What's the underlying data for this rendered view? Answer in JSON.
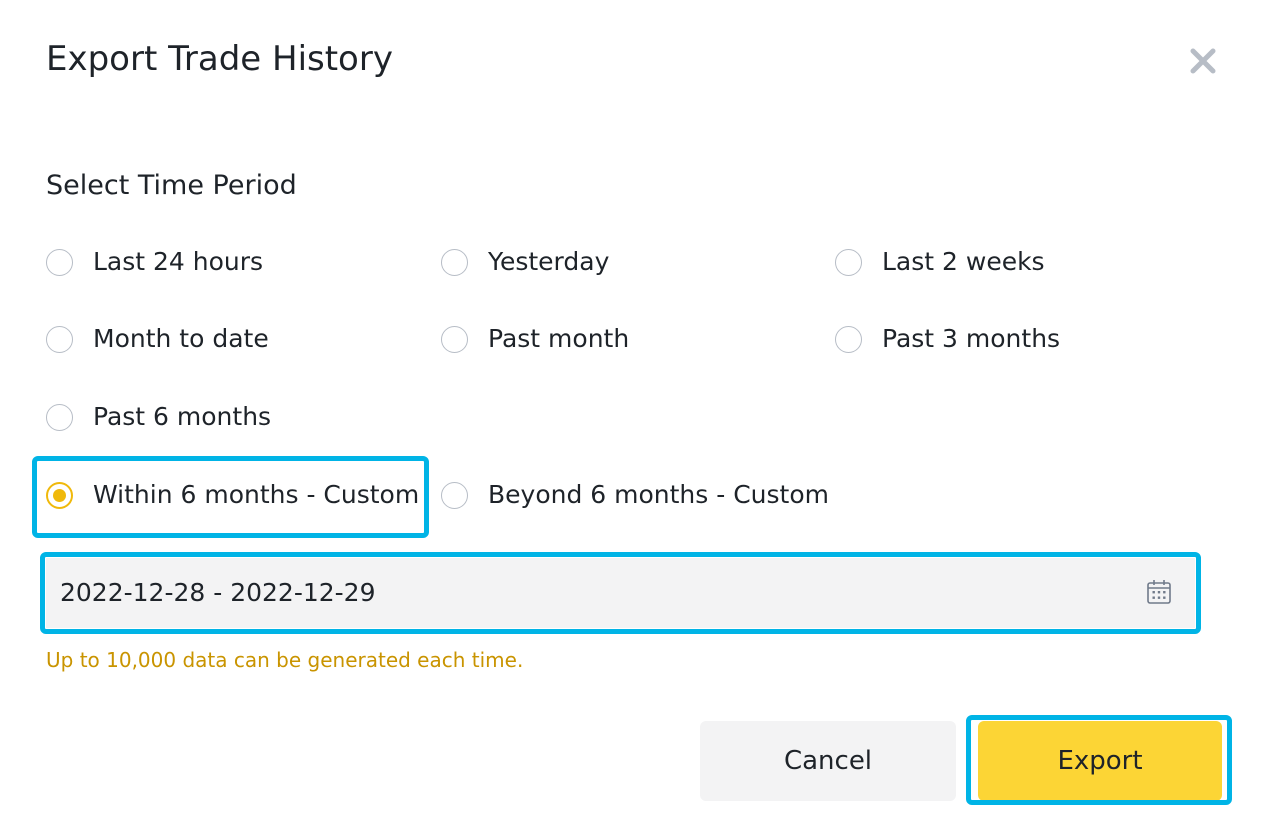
{
  "dialog": {
    "title": "Export Trade History",
    "close_icon": "close-icon"
  },
  "time_period": {
    "label": "Select Time Period",
    "selected": "Within 6 months - Custom",
    "options": [
      {
        "label": "Last 24 hours",
        "checked": false
      },
      {
        "label": "Yesterday",
        "checked": false
      },
      {
        "label": "Last 2 weeks",
        "checked": false
      },
      {
        "label": "Month to date",
        "checked": false
      },
      {
        "label": "Past month",
        "checked": false
      },
      {
        "label": "Past 3 months",
        "checked": false
      },
      {
        "label": "Past 6 months",
        "checked": false
      },
      {
        "label": "Within 6 months - Custom",
        "checked": true
      },
      {
        "label": "Beyond 6 months - Custom",
        "checked": false
      }
    ]
  },
  "date_range": {
    "value": "2022-12-28 - 2022-12-29",
    "icon": "calendar-icon"
  },
  "hint": "Up to 10,000 data can be generated each time.",
  "buttons": {
    "cancel": "Cancel",
    "export": "Export"
  },
  "colors": {
    "accent": "#f0b90b",
    "export_button": "#fcd535",
    "highlight": "#00b4e6",
    "hint_text": "#c99400"
  }
}
